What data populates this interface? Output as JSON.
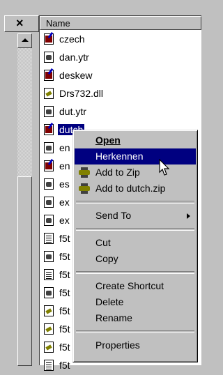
{
  "header": {
    "close_glyph": "×",
    "column_name": "Name"
  },
  "files": [
    {
      "name": "czech",
      "icon": "exe-icon"
    },
    {
      "name": "dan.ytr",
      "icon": "doc-icon"
    },
    {
      "name": "deskew",
      "icon": "exe-icon"
    },
    {
      "name": "Drs732.dll",
      "icon": "dll-icon"
    },
    {
      "name": "dut.ytr",
      "icon": "doc-icon"
    },
    {
      "name": "dutch",
      "icon": "exe-icon",
      "selected": true
    },
    {
      "name": "en",
      "icon": "doc-icon"
    },
    {
      "name": "en",
      "icon": "exe-icon"
    },
    {
      "name": "es",
      "icon": "doc-icon"
    },
    {
      "name": "ex",
      "icon": "doc-icon"
    },
    {
      "name": "ex",
      "icon": "doc-icon"
    },
    {
      "name": "f5t",
      "icon": "txt-icon"
    },
    {
      "name": "f5t",
      "icon": "doc-icon"
    },
    {
      "name": "f5t",
      "icon": "txt-icon"
    },
    {
      "name": "f5t",
      "icon": "doc-icon"
    },
    {
      "name": "f5t",
      "icon": "dll-icon"
    },
    {
      "name": "f5t",
      "icon": "dll-icon"
    },
    {
      "name": "f5t",
      "icon": "dll-icon"
    },
    {
      "name": "f5t",
      "icon": "txt-icon"
    }
  ],
  "context_menu": {
    "open": "Open",
    "herkennen": "Herkennen",
    "add_to_zip": "Add to Zip",
    "add_to_dutch_zip": "Add to dutch.zip",
    "send_to": "Send To",
    "cut": "Cut",
    "copy": "Copy",
    "create_shortcut": "Create Shortcut",
    "delete": "Delete",
    "rename": "Rename",
    "properties": "Properties"
  },
  "colors": {
    "selection": "#000080",
    "face": "#c0c0c0"
  }
}
